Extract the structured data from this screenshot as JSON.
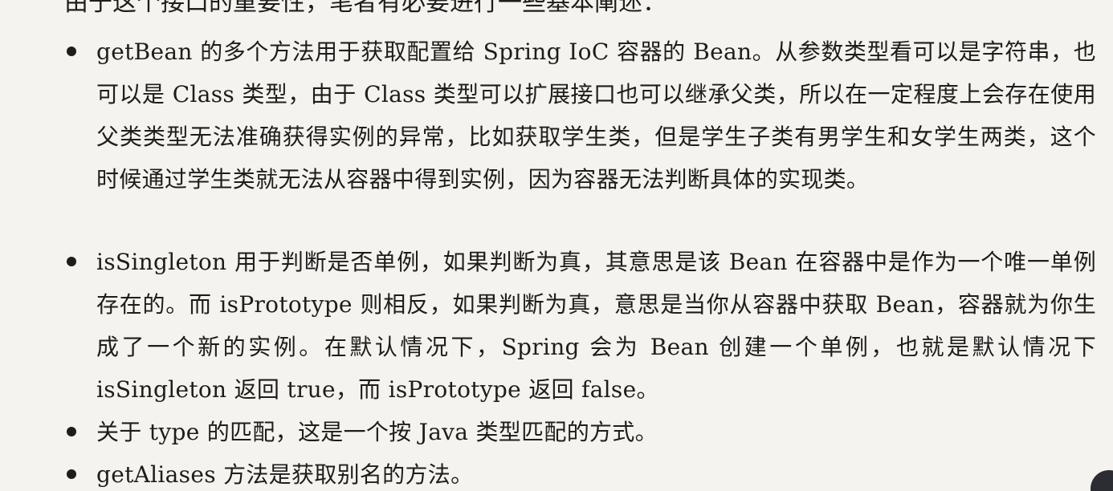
{
  "intro_text": "由于这个接口的重要性，笔者有必要进行一些基本阐述：",
  "bullets": [
    {
      "text": "getBean 的多个方法用于获取配置给 Spring IoC 容器的 Bean。从参数类型看可以是字符串，也可以是 Class 类型，由于 Class 类型可以扩展接口也可以继承父类，所以在一定程度上会存在使用父类类型无法准确获得实例的异常，比如获取学生类，但是学生子类有男学生和女学生两类，这个时候通过学生类就无法从容器中得到实例，因为容器无法判断具体的实现类。"
    },
    {
      "text": "isSingleton 用于判断是否单例，如果判断为真，其意思是该 Bean 在容器中是作为一个唯一单例存在的。而 isPrototype 则相反，如果判断为真，意思是当你从容器中获取 Bean，容器就为你生成了一个新的实例。在默认情况下，Spring 会为 Bean 创建一个单例，也就是默认情况下 isSingleton 返回 true，而 isPrototype 返回 false。"
    },
    {
      "text": "关于 type 的匹配，这是一个按 Java 类型匹配的方式。"
    },
    {
      "text": "getAliases 方法是获取别名的方法。"
    }
  ]
}
